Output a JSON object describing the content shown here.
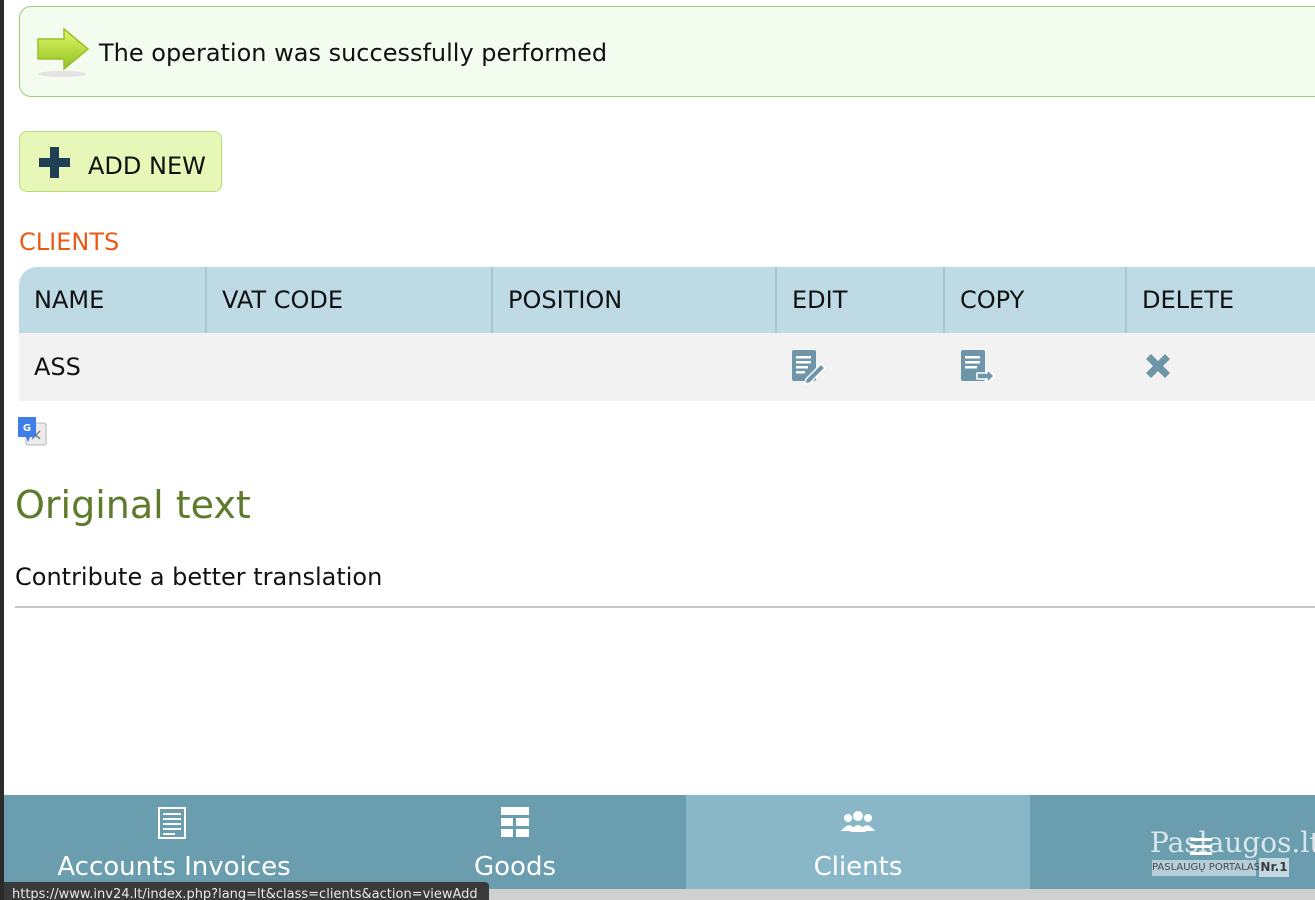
{
  "alert": {
    "message": "The operation was successfully performed"
  },
  "toolbar": {
    "add_new_label": "ADD NEW"
  },
  "section": {
    "title": "CLIENTS"
  },
  "table": {
    "columns": [
      "NAME",
      "VAT CODE",
      "POSITION",
      "EDIT",
      "COPY",
      "DELETE"
    ],
    "rows": [
      {
        "name": "ASS",
        "vat_code": "",
        "position": ""
      }
    ]
  },
  "translate": {
    "original_title": "Original text",
    "contribute_label": "Contribute a better translation"
  },
  "bottom_nav": {
    "items": [
      {
        "label": "Accounts Invoices",
        "icon": "invoice-icon"
      },
      {
        "label": "Goods",
        "icon": "grid-icon"
      },
      {
        "label": "Clients",
        "icon": "clients-icon",
        "active": true
      }
    ]
  },
  "watermark": {
    "brand": "Paslaugos.lt",
    "sub": "PASLAUGŲ PORTALAS",
    "badge": "Nr.1"
  },
  "status_bar": {
    "url": "https://www.inv24.lt/index.php?lang=lt&class=clients&action=viewAdd"
  },
  "colors": {
    "accent_orange": "#ea5b16",
    "header_blue": "#bedbe5",
    "nav_blue": "#6a9dae",
    "nav_active": "#89b7c7",
    "success_green": "#9ccf6e"
  }
}
